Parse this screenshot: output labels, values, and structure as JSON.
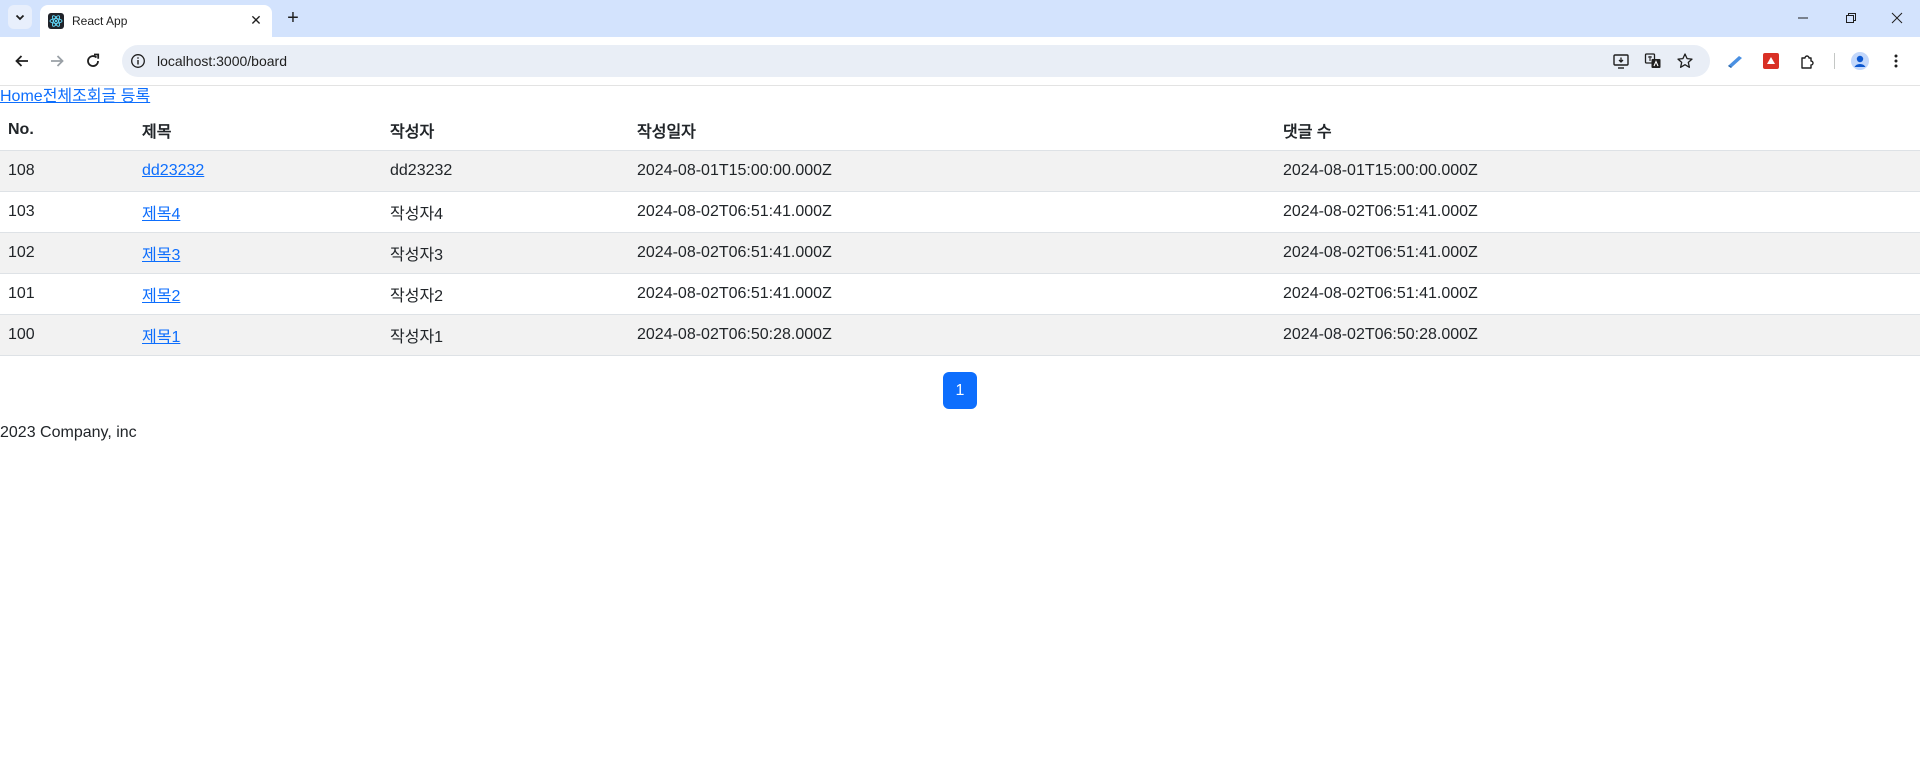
{
  "browser": {
    "tab_title": "React App",
    "tab_close": "✕",
    "new_tab": "+",
    "url": "localhost:3000/board",
    "accent": "#d3e3fd"
  },
  "nav": {
    "home": "Home",
    "list_all": "전체조회",
    "write": "글 등록"
  },
  "table": {
    "headers": [
      "No.",
      "제목",
      "작성자",
      "작성일자",
      "댓글 수"
    ],
    "rows": [
      {
        "no": "108",
        "title": "dd23232",
        "author": "dd23232",
        "date": "2024-08-01T15:00:00.000Z",
        "comments": "2024-08-01T15:00:00.000Z"
      },
      {
        "no": "103",
        "title": "제목4",
        "author": "작성자4",
        "date": "2024-08-02T06:51:41.000Z",
        "comments": "2024-08-02T06:51:41.000Z"
      },
      {
        "no": "102",
        "title": "제목3",
        "author": "작성자3",
        "date": "2024-08-02T06:51:41.000Z",
        "comments": "2024-08-02T06:51:41.000Z"
      },
      {
        "no": "101",
        "title": "제목2",
        "author": "작성자2",
        "date": "2024-08-02T06:51:41.000Z",
        "comments": "2024-08-02T06:51:41.000Z"
      },
      {
        "no": "100",
        "title": "제목1",
        "author": "작성자1",
        "date": "2024-08-02T06:50:28.000Z",
        "comments": "2024-08-02T06:50:28.000Z"
      }
    ]
  },
  "pagination": {
    "current": "1",
    "color": "#0d6efd"
  },
  "footer": {
    "text": "2023 Company, inc"
  },
  "icons": {
    "tab_search": "chevron-down-icon",
    "favicon": "react-icon",
    "back": "arrow-left-icon",
    "forward": "arrow-right-icon",
    "reload": "reload-icon",
    "site_info": "info-icon",
    "install": "install-app-icon",
    "translate": "translate-icon",
    "bookmark": "star-icon",
    "extensions": "puzzle-icon",
    "profile": "profile-icon",
    "menu": "kebab-menu-icon"
  }
}
